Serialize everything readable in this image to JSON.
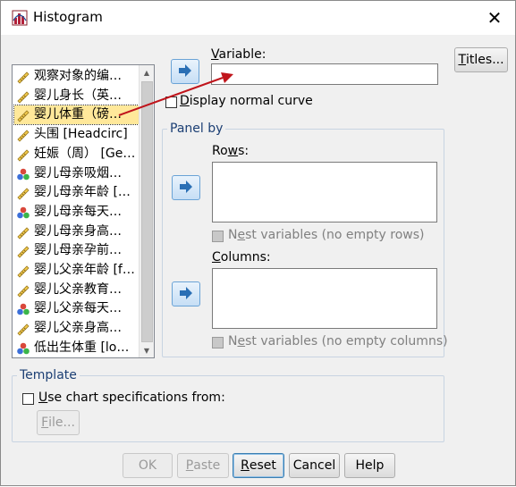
{
  "window": {
    "title": "Histogram",
    "close_glyph": "✕"
  },
  "variables": [
    {
      "label": "观察对象的编…",
      "icon": "ruler-icon"
    },
    {
      "label": "婴儿身长（英…",
      "icon": "ruler-icon"
    },
    {
      "label": "婴儿体重（磅…",
      "icon": "ruler-icon",
      "selected": true
    },
    {
      "label": "头围 [Headcirc]",
      "icon": "ruler-icon"
    },
    {
      "label": "妊娠（周） [Ge…",
      "icon": "ruler-icon"
    },
    {
      "label": "婴儿母亲吸烟…",
      "icon": "nominal-icon"
    },
    {
      "label": "婴儿母亲年龄 […",
      "icon": "ruler-icon"
    },
    {
      "label": "婴儿母亲每天…",
      "icon": "nominal-icon"
    },
    {
      "label": "婴儿母亲身高…",
      "icon": "ruler-icon"
    },
    {
      "label": "婴儿母亲孕前…",
      "icon": "ruler-icon"
    },
    {
      "label": "婴儿父亲年龄 [f…",
      "icon": "ruler-icon"
    },
    {
      "label": "婴儿父亲教育…",
      "icon": "ruler-icon"
    },
    {
      "label": "婴儿父亲每天…",
      "icon": "nominal-icon"
    },
    {
      "label": "婴儿父亲身高…",
      "icon": "ruler-icon"
    },
    {
      "label": "低出生体重 [lo…",
      "icon": "nominal-icon"
    }
  ],
  "variable_section": {
    "label_prefix": "",
    "label_u": "V",
    "label_rest": "ariable:",
    "value": ""
  },
  "normal_curve": {
    "label_u": "D",
    "label_rest": "isplay normal curve",
    "checked": false
  },
  "panel_by": {
    "title": "Panel by",
    "rows": {
      "label_prefix": "Ro",
      "label_u": "w",
      "label_rest": "s:"
    },
    "rows_nest": {
      "prefix": "N",
      "u": "e",
      "rest": "st variables (no empty rows)"
    },
    "columns": {
      "label_prefix": "",
      "label_u": "C",
      "label_rest": "olumns:"
    },
    "columns_nest": {
      "prefix": "N",
      "u": "e",
      "rest": "st variables (no empty columns)"
    }
  },
  "template": {
    "title": "Template",
    "use_spec": {
      "label_u": "U",
      "label_rest": "se chart specifications from:"
    },
    "file_button": {
      "u": "F",
      "rest": "ile..."
    }
  },
  "titles_button": {
    "u": "T",
    "rest": "itles..."
  },
  "buttons": {
    "ok": "OK",
    "paste": {
      "u": "P",
      "rest": "aste"
    },
    "reset": {
      "u": "R",
      "rest": "eset"
    },
    "cancel": "Cancel",
    "help": "Help"
  },
  "colors": {
    "accent": "#3c7fb1",
    "selected_row": "#ffe89a",
    "drag_arrow": "#c0141b",
    "group_title": "#1c3f74"
  }
}
